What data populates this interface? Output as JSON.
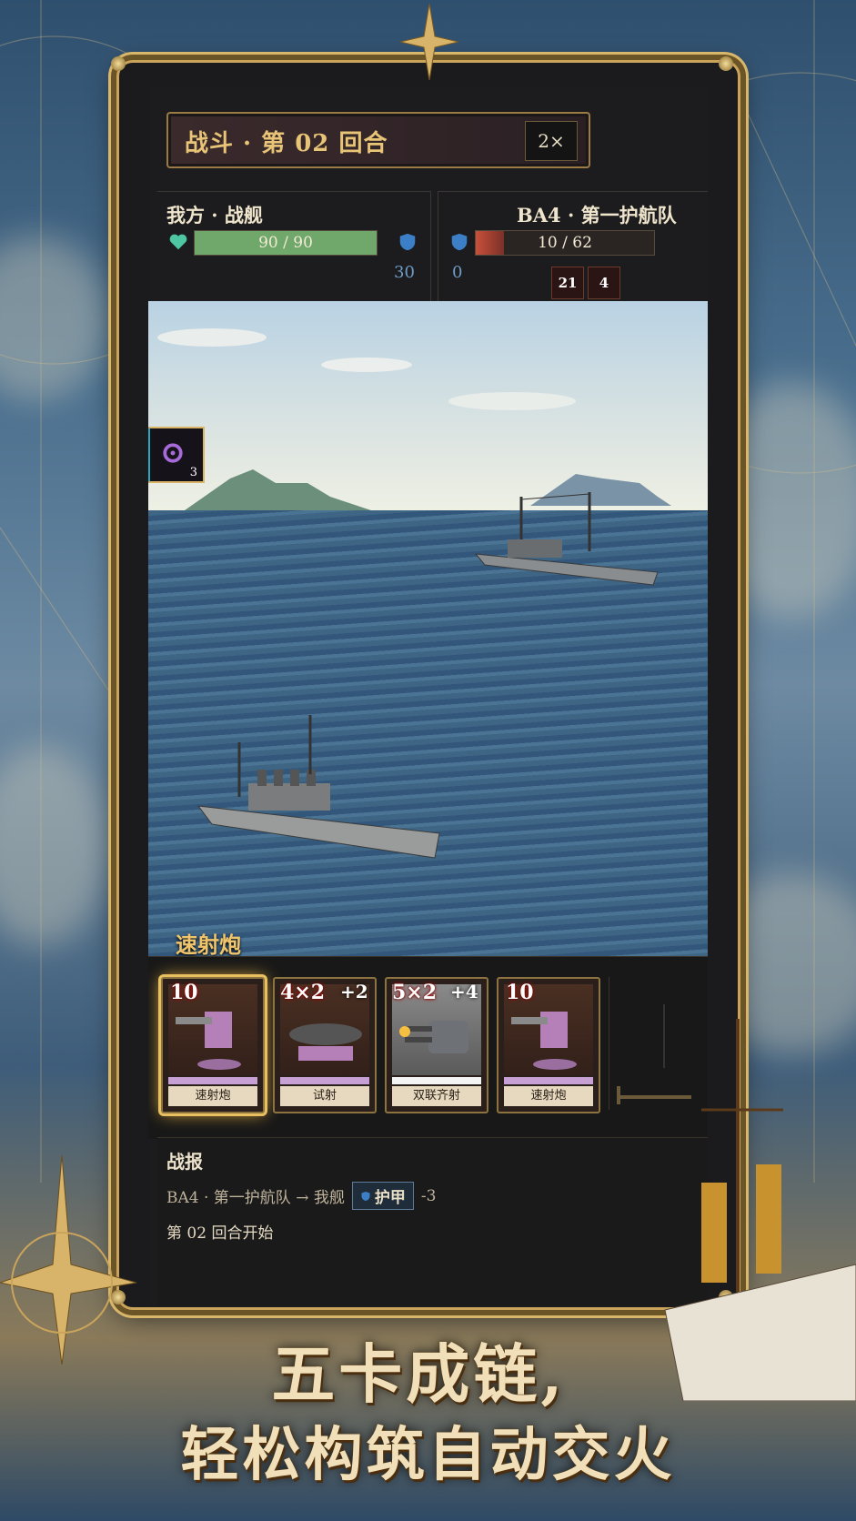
{
  "header": {
    "title": "战斗 · 第 02 回合",
    "speed": "2×"
  },
  "player": {
    "name": "我方 · 战舰",
    "hp_text": "90 / 90",
    "hp_fraction": 1.0,
    "armor": "30"
  },
  "enemy": {
    "name": "BA4 · 第一护航队",
    "hp_text": "10 / 62",
    "hp_fraction": 0.16,
    "armor": "0",
    "intents": [
      "21",
      "4"
    ]
  },
  "scene": {
    "status_count": "3"
  },
  "hand": {
    "header": "速射炮",
    "cards": [
      {
        "label": "速射炮",
        "damage": "10",
        "buff": ""
      },
      {
        "label": "试射",
        "damage": "4×2",
        "buff": "+2"
      },
      {
        "label": "双联齐射",
        "damage": "5×2",
        "buff": "+4"
      },
      {
        "label": "速射炮",
        "damage": "10",
        "buff": ""
      }
    ],
    "slot_progress": [
      0.65,
      0,
      0,
      0,
      0
    ]
  },
  "log": {
    "title": "战报",
    "line1_prefix": "BA4 · 第一护航队 → 我舰",
    "line1_chip": "护甲",
    "line1_value": "-3",
    "line2": "第 02 回合开始"
  },
  "slogan": {
    "line1": "五卡成链,",
    "line2": "轻松构筑自动交火"
  },
  "colors": {
    "gold": "#c9a45a",
    "hp_player": "#6fa86a",
    "hp_enemy": "#c9503a",
    "armor": "#3d7fc7",
    "heal": "#4fc6a2"
  }
}
